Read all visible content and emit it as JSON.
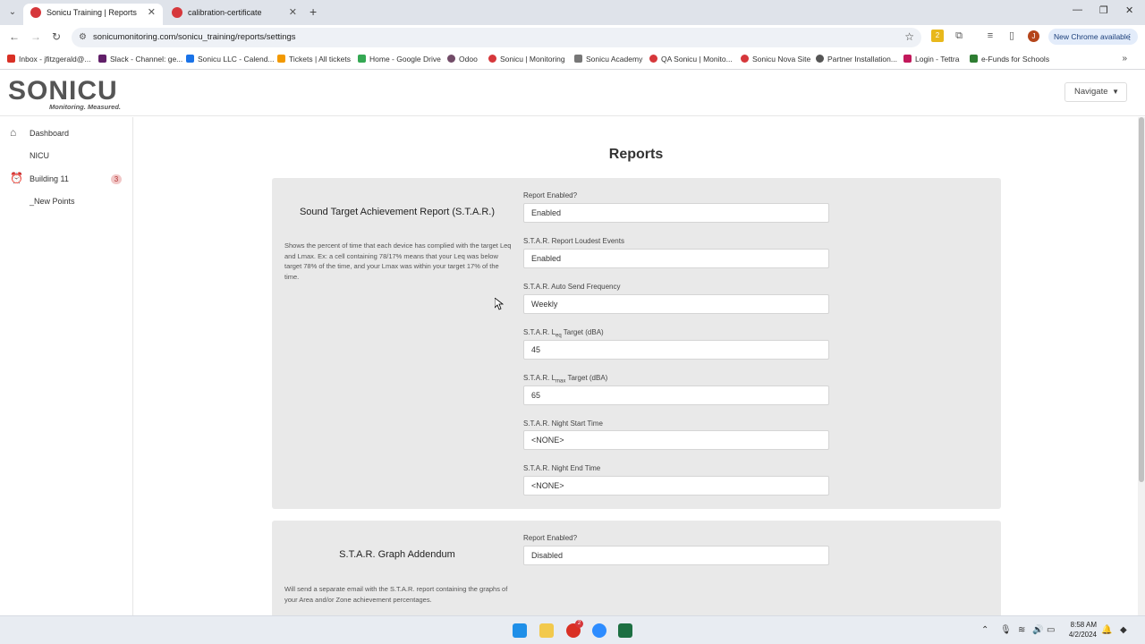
{
  "browser": {
    "tabs": [
      {
        "label": "Sonicu Training | Reports",
        "active": true
      },
      {
        "label": "calibration-certificate",
        "active": false
      }
    ],
    "url": "sonicumonitoring.com/sonicu_training/reports/settings",
    "new_chrome_label": "New Chrome available",
    "avatar_letter": "J",
    "bookmarks": [
      "Inbox - jfitzgerald@...",
      "Slack - Channel: ge...",
      "Sonicu LLC - Calend...",
      "Tickets | All tickets",
      "Home - Google Drive",
      "Odoo",
      "Sonicu | Monitoring",
      "Sonicu Academy",
      "QA Sonicu | Monito...",
      "Sonicu Nova Site",
      "Partner Installation...",
      "Login - Tettra",
      "e-Funds for Schools"
    ]
  },
  "app": {
    "logo_text": "SONICU",
    "logo_tagline": "Monitoring. Measured.",
    "navigate_label": "Navigate",
    "sidebar": {
      "items": [
        {
          "label": "Dashboard",
          "icon": "home-icon"
        },
        {
          "label": "NICU"
        },
        {
          "label": "Building 11",
          "icon": "alarm-clock-icon",
          "badge": "3"
        },
        {
          "label": "_New Points"
        }
      ]
    },
    "page_title": "Reports",
    "star_card": {
      "title": "Sound Target Achievement Report (S.T.A.R.)",
      "description": "Shows the percent of time that each device has complied with the target Leq and Lmax. Ex: a cell containing 78/17% means that your Leq was below target 78% of the time, and your Lmax was within your target 17% of the time.",
      "fields": [
        {
          "label": "Report Enabled?",
          "value": "Enabled"
        },
        {
          "label": "S.T.A.R. Report Loudest Events",
          "value": "Enabled"
        },
        {
          "label": "S.T.A.R. Auto Send Frequency",
          "value": "Weekly"
        },
        {
          "label_prefix": "S.T.A.R. L",
          "label_sub": "eq",
          "label_suffix": " Target (dBA)",
          "value": "45"
        },
        {
          "label_prefix": "S.T.A.R. L",
          "label_sub": "max",
          "label_suffix": " Target (dBA)",
          "value": "65"
        },
        {
          "label": "S.T.A.R. Night Start Time",
          "value": "<NONE>"
        },
        {
          "label": "S.T.A.R. Night End Time",
          "value": "<NONE>"
        }
      ]
    },
    "graph_card": {
      "title": "S.T.A.R. Graph Addendum",
      "description": "Will send a separate email with the S.T.A.R. report containing the graphs of your Area and/or Zone achievement percentages.",
      "fields": [
        {
          "label": "Report Enabled?",
          "value": "Disabled"
        }
      ]
    }
  },
  "taskbar": {
    "time": "8:58 AM",
    "date": "4/2/2024",
    "chrome_badge": "2"
  },
  "colors": {
    "accent_red": "#d6373b",
    "card_bg": "#e9e9e9",
    "badge_bg": "#f1c7c7"
  }
}
